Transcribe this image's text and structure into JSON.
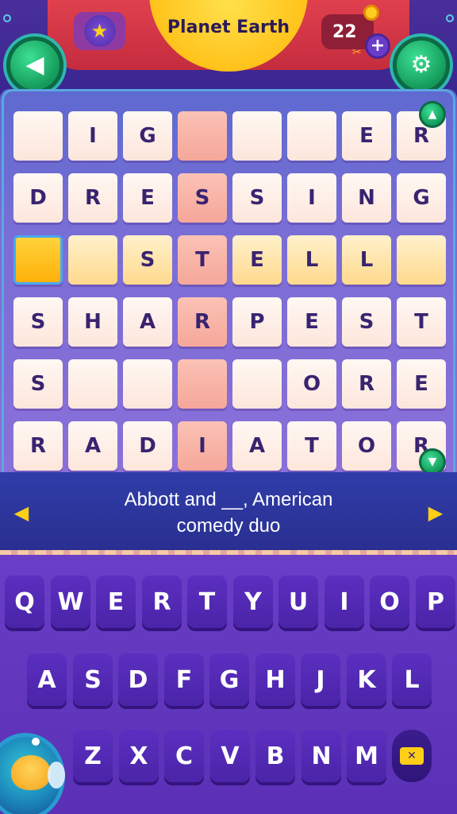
{
  "header": {
    "title": "Planet Earth",
    "coins": "22",
    "add_coins_label": "+",
    "category_icon": "star-icon",
    "back_icon": "back-arrow-icon",
    "settings_icon": "gear-icon"
  },
  "grid": {
    "rows": [
      [
        "",
        "I",
        "G",
        "",
        "",
        "",
        "E",
        "R"
      ],
      [
        "D",
        "R",
        "E",
        "S",
        "S",
        "I",
        "N",
        "G"
      ],
      [
        "",
        "",
        "S",
        "T",
        "E",
        "L",
        "L",
        ""
      ],
      [
        "S",
        "H",
        "A",
        "R",
        "P",
        "E",
        "S",
        "T"
      ],
      [
        "S",
        "",
        "",
        "",
        "",
        "O",
        "R",
        "E"
      ],
      [
        "R",
        "A",
        "D",
        "I",
        "A",
        "T",
        "O",
        "R"
      ]
    ],
    "highlight_column": 3,
    "active_row": 2,
    "active_col": 0
  },
  "clue": {
    "line1": "Abbott and __, American",
    "line2": "comedy duo",
    "prev_icon": "chevron-left-icon",
    "next_icon": "chevron-right-icon"
  },
  "keyboard": {
    "row1": [
      "Q",
      "W",
      "E",
      "R",
      "T",
      "Y",
      "U",
      "I",
      "O",
      "P"
    ],
    "row2": [
      "A",
      "S",
      "D",
      "F",
      "G",
      "H",
      "J",
      "K",
      "L"
    ],
    "row3": [
      "Z",
      "X",
      "C",
      "V",
      "B",
      "N",
      "M"
    ],
    "delete_icon": "backspace-icon"
  },
  "colors": {
    "header_red": "#d63447",
    "title_yellow": "#ffc21a",
    "tile_pink": "#f5a79a",
    "tile_yellow": "#ffd98c",
    "active_tile": "#ffc21a",
    "keyboard_purple": "#5b2fc0",
    "accent_green": "#22b86e"
  }
}
